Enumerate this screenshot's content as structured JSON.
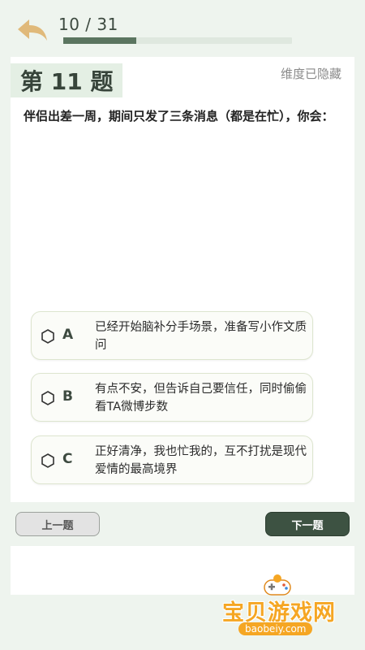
{
  "header": {
    "progress_text": "10 / 31",
    "progress_fraction": 0.32
  },
  "question": {
    "number_label": "第 11 题",
    "dimension_status": "维度已隐藏",
    "text": "伴侣出差一周，期间只发了三条消息（都是在忙），你会："
  },
  "options": [
    {
      "letter": "A",
      "text": "已经开始脑补分手场景，准备写小作文质问"
    },
    {
      "letter": "B",
      "text": "有点不安，但告诉自己要信任，同时偷偷看TA微博步数"
    },
    {
      "letter": "C",
      "text": "正好清净，我也忙我的，互不打扰是现代爱情的最高境界"
    }
  ],
  "nav": {
    "prev_label": "上一题",
    "next_label": "下一题"
  },
  "watermark": {
    "brand": "宝贝游戏网",
    "url": "baobeiy.com"
  },
  "colors": {
    "background": "#eef4ee",
    "accent": "#3d5242",
    "progress_fill": "#5b7560",
    "watermark_orange": "#f5a623"
  }
}
